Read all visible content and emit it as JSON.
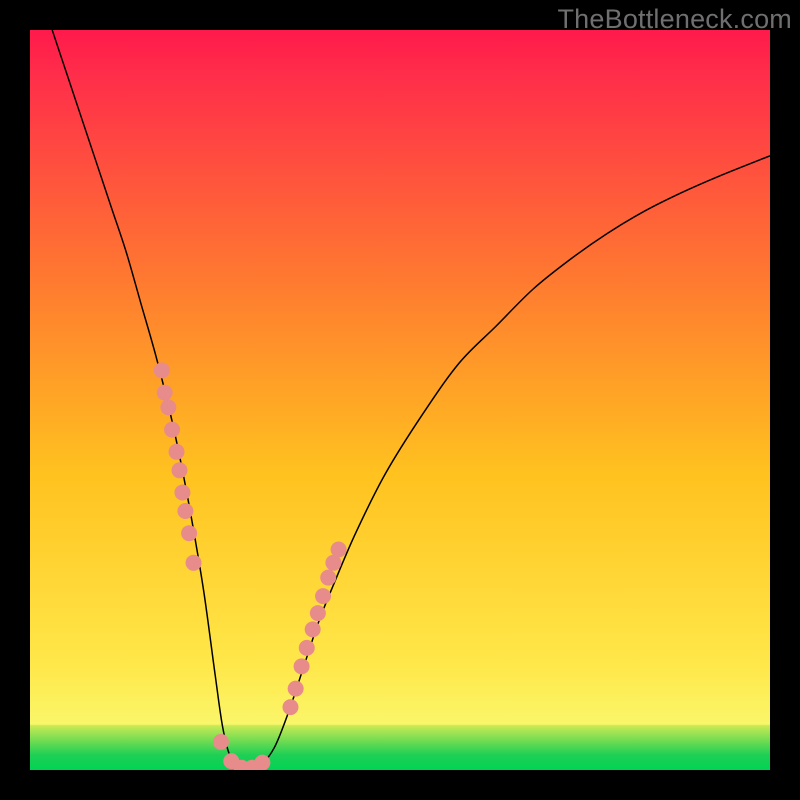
{
  "watermark": "TheBottleneck.com",
  "chart_data": {
    "type": "line",
    "title": "",
    "xlabel": "",
    "ylabel": "",
    "xlim": [
      0,
      100
    ],
    "ylim": [
      0,
      100
    ],
    "background_gradient": {
      "top_color": "#ff1a4b",
      "mid_color": "#ffd11a",
      "bottom_band_color": "#00d455",
      "bottom_band_start": 94
    },
    "series": [
      {
        "name": "curve",
        "color": "#000000",
        "stroke_width": 1.5,
        "x": [
          3,
          5,
          7,
          9,
          11,
          13,
          15,
          17,
          19,
          20.5,
          22,
          23.5,
          25,
          26,
          27,
          28.5,
          31,
          33,
          35,
          37,
          39,
          41,
          44,
          48,
          53,
          58,
          63,
          68,
          73,
          78,
          83,
          88,
          93,
          100
        ],
        "y": [
          100,
          94,
          88,
          82,
          76,
          70,
          63,
          56,
          48,
          41,
          33,
          24,
          13,
          6,
          2,
          0.3,
          0.6,
          3,
          8,
          14,
          20,
          25,
          32,
          40,
          48,
          55,
          60,
          65,
          69,
          72.5,
          75.5,
          78,
          80.2,
          83
        ]
      }
    ],
    "scatter": [
      {
        "name": "left-cluster",
        "color": "#e88b8b",
        "radius": 8,
        "points": [
          [
            17.8,
            54
          ],
          [
            18.2,
            51
          ],
          [
            18.7,
            49
          ],
          [
            19.2,
            46
          ],
          [
            19.8,
            43
          ],
          [
            20.2,
            40.5
          ],
          [
            20.6,
            37.5
          ],
          [
            21.0,
            35
          ],
          [
            21.5,
            32
          ],
          [
            22.1,
            28
          ]
        ]
      },
      {
        "name": "bottom-cluster",
        "color": "#e88b8b",
        "radius": 8,
        "points": [
          [
            25.8,
            3.8
          ],
          [
            27.2,
            1.2
          ],
          [
            28.6,
            0.3
          ],
          [
            30.0,
            0.3
          ],
          [
            31.4,
            1.0
          ]
        ]
      },
      {
        "name": "right-cluster",
        "color": "#e88b8b",
        "radius": 8,
        "points": [
          [
            35.2,
            8.5
          ],
          [
            35.9,
            11
          ],
          [
            36.7,
            14
          ],
          [
            37.4,
            16.5
          ],
          [
            38.2,
            19
          ],
          [
            38.9,
            21.2
          ],
          [
            39.6,
            23.5
          ],
          [
            40.3,
            26
          ],
          [
            41.0,
            28.0
          ],
          [
            41.7,
            29.8
          ]
        ]
      }
    ]
  }
}
